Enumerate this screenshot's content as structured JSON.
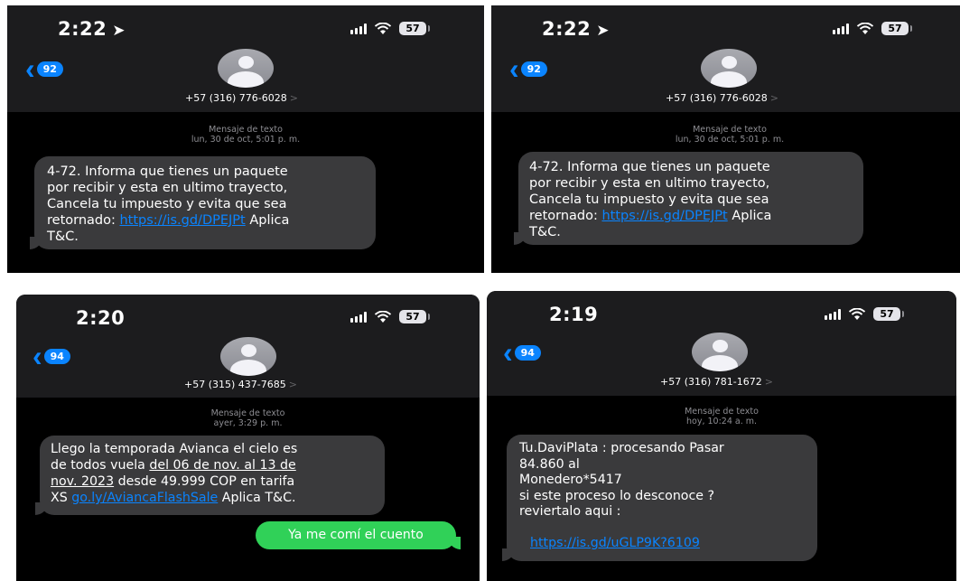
{
  "screens": [
    {
      "time": "2:22",
      "has_location_arrow": true,
      "battery": "57",
      "back_count": "92",
      "contact_number": "+57 (316) 776-6028",
      "meta_title": "Mensaje de texto",
      "meta_time": "lun, 30 de oct, 5:01 p. m.",
      "message_part1": "4-72. Informa que tienes un paquete\npor recibir y esta en ultimo trayecto,\nCancela tu impuesto y evita que sea\nretornado: ",
      "message_link": "https://is.gd/DPEJPt",
      "message_part2": " Aplica\nT&C."
    },
    {
      "time": "2:22",
      "has_location_arrow": true,
      "battery": "57",
      "back_count": "92",
      "contact_number": "+57 (316) 776-6028",
      "meta_title": "Mensaje de texto",
      "meta_time": "lun, 30 de oct, 5:01 p. m.",
      "message_part1": "4-72. Informa que tienes un paquete\npor recibir y esta en ultimo trayecto,\nCancela tu impuesto y evita que sea\nretornado: ",
      "message_link": "https://is.gd/DPEJPt",
      "message_part2": " Aplica\nT&C."
    },
    {
      "time": "2:20",
      "battery": "57",
      "back_count": "94",
      "contact_number": "+57 (315) 437-7685",
      "meta_title": "Mensaje de texto",
      "meta_time": "ayer, 3:29 p. m.",
      "message_part1": "Llego la temporada Avianca el cielo es\nde todos vuela ",
      "message_underline": "del 06 de nov. al 13 de\nnov. 2023",
      "message_part2": " desde 49.999 COP en tarifa\nXS ",
      "message_link": "go.ly/AviancaFlashSale",
      "message_part3": " Aplica T&C.",
      "reply": "Ya me comí el cuento"
    },
    {
      "time": "2:19",
      "battery": "57",
      "back_count": "94",
      "contact_number": "+57 (316) 781-1672",
      "meta_title": "Mensaje de texto",
      "meta_time": "hoy, 10:24 a. m.",
      "message_part1": "Tu.DaviPlata : procesando Pasar\n84.860 al\nMonedero*5417\nsi este proceso lo desconoce ?\nreviertalo aqui :\n\n",
      "message_link": "https://is.gd/uGLP9K?6109"
    }
  ],
  "colors": {
    "ios_blue": "#0a84ff",
    "imessage_green": "#30d158",
    "bubble_gray": "#3a3a3c",
    "header_bg": "#1c1c1e"
  },
  "icons": [
    "location-arrow-icon",
    "signal-icon",
    "wifi-icon",
    "battery-icon",
    "back-chevron-icon",
    "contact-avatar-icon"
  ]
}
